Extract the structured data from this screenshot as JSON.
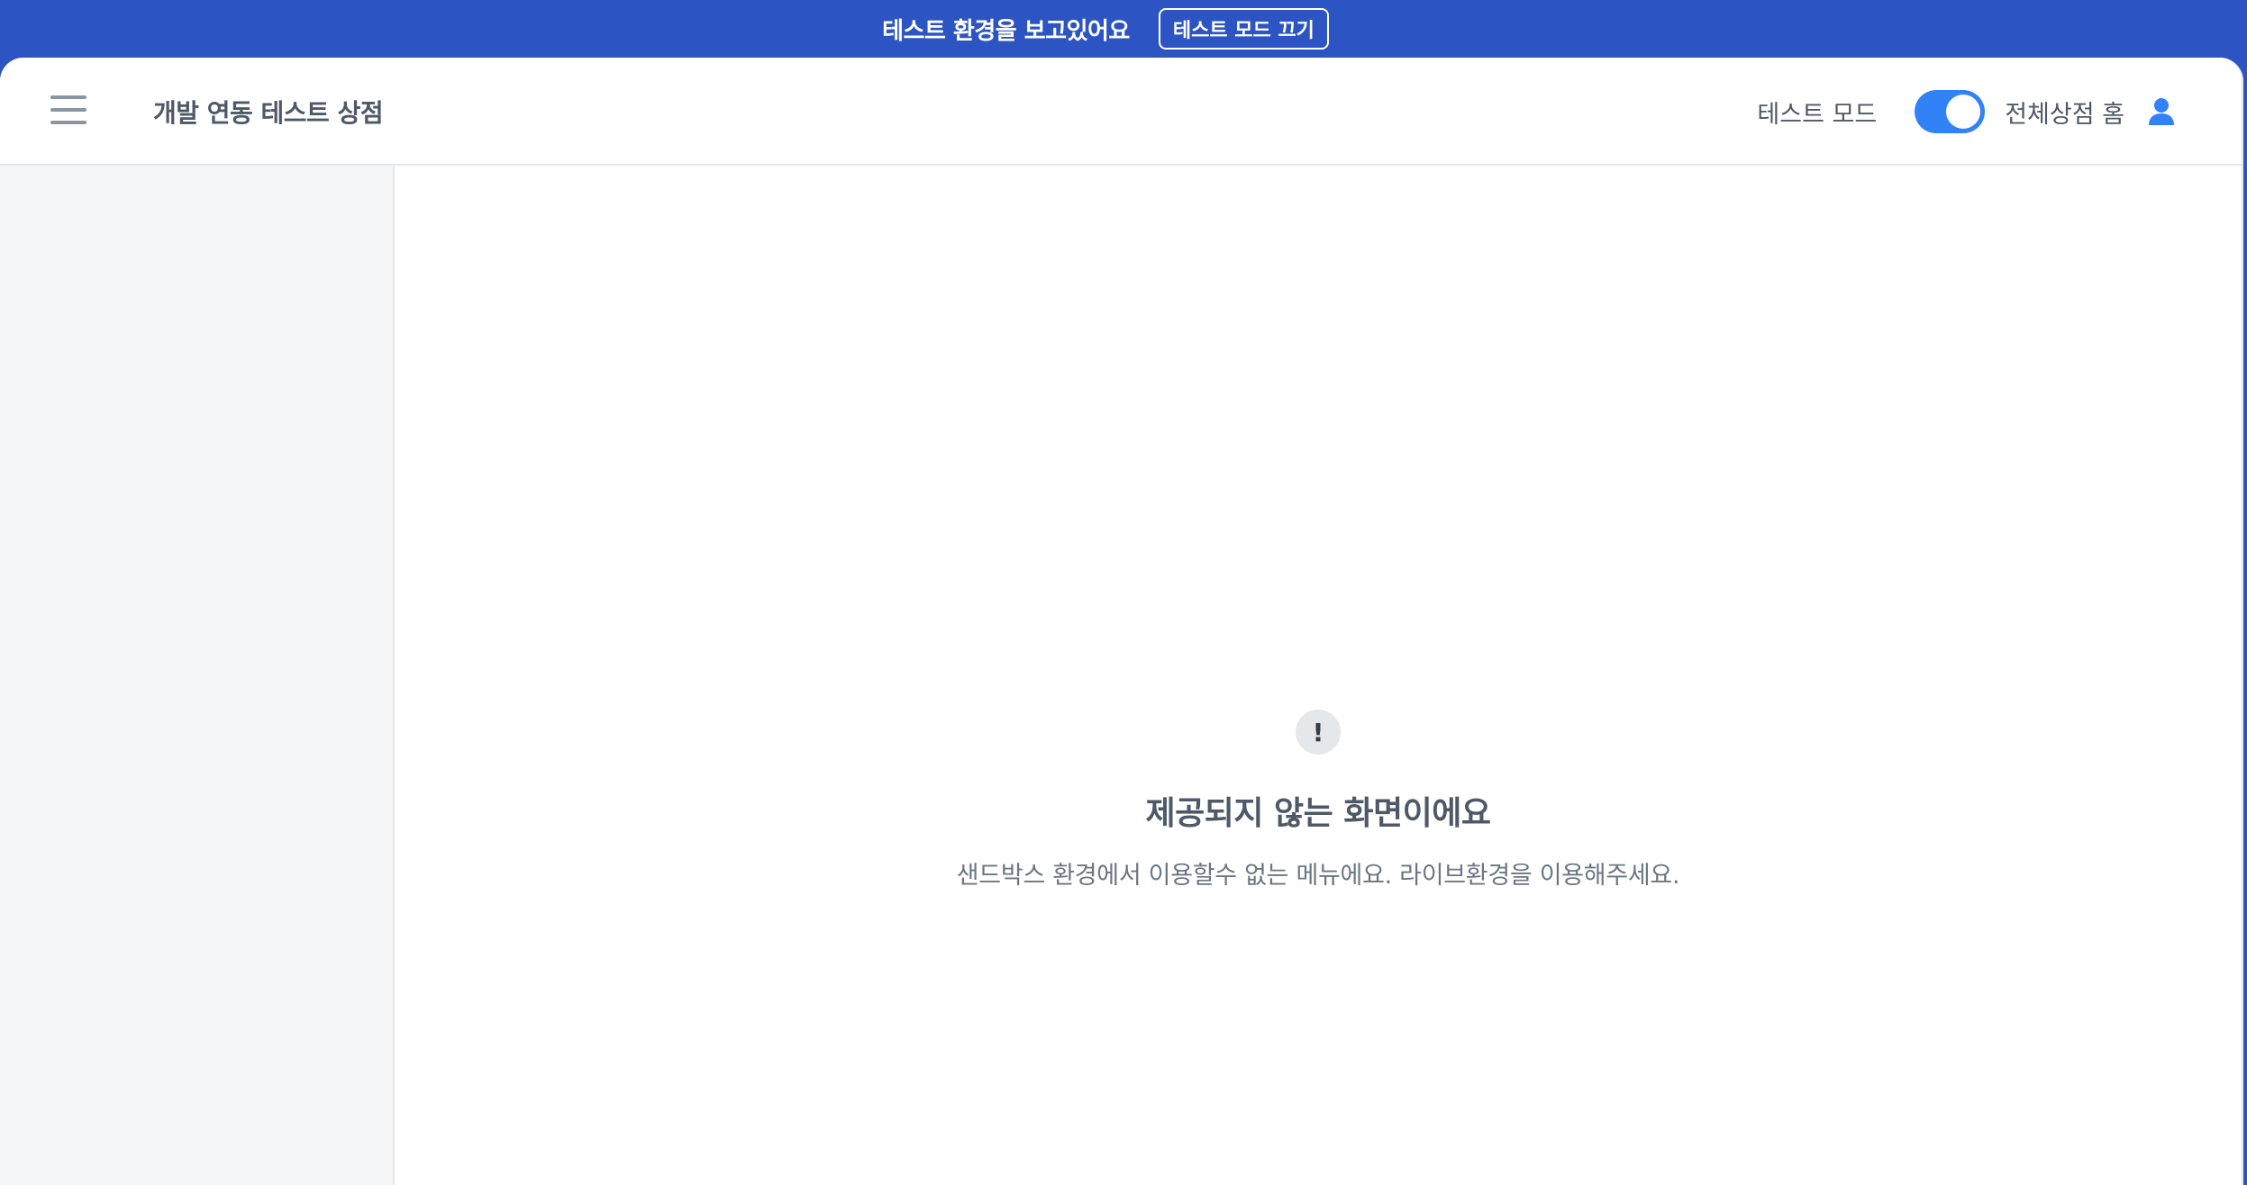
{
  "banner": {
    "text": "테스트 환경을 보고있어요",
    "button_label": "테스트 모드 끄기"
  },
  "header": {
    "store_title": "개발 연동 테스트 상점",
    "test_mode_label": "테스트 모드",
    "test_mode_enabled": true,
    "store_home_link": "전체상점 홈",
    "menu_icon": "hamburger-menu-icon",
    "user_icon": "user-icon"
  },
  "colors": {
    "banner_bg": "#2c55c3",
    "toggle_on": "#3182f6",
    "sidebar_bg": "#f5f6f8",
    "user_icon": "#3182f6"
  },
  "empty_state": {
    "icon": "exclamation-icon",
    "icon_glyph": "!",
    "title": "제공되지 않는 화면이에요",
    "description": "샌드박스 환경에서 이용할수 없는 메뉴에요. 라이브환경을 이용해주세요."
  }
}
